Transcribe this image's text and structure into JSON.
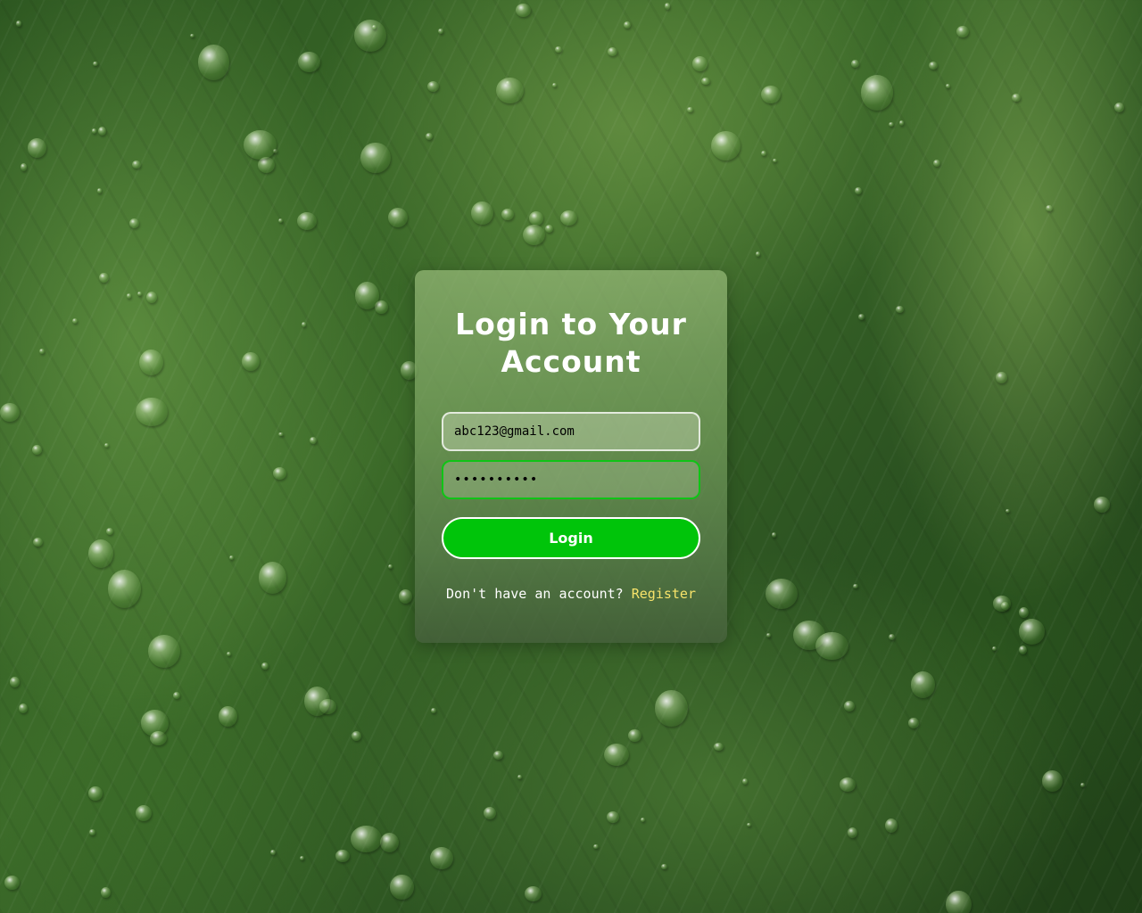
{
  "login": {
    "title": "Login to Your Account",
    "email_value": "abc123@gmail.com",
    "password_value": "••••••••••",
    "login_button_label": "Login",
    "register_prompt": "Don't have an account?",
    "register_link_label": "Register"
  },
  "colors": {
    "accent_green": "#00c40a",
    "focus_border": "#0fc416",
    "link_yellow": "#f7e36a"
  }
}
